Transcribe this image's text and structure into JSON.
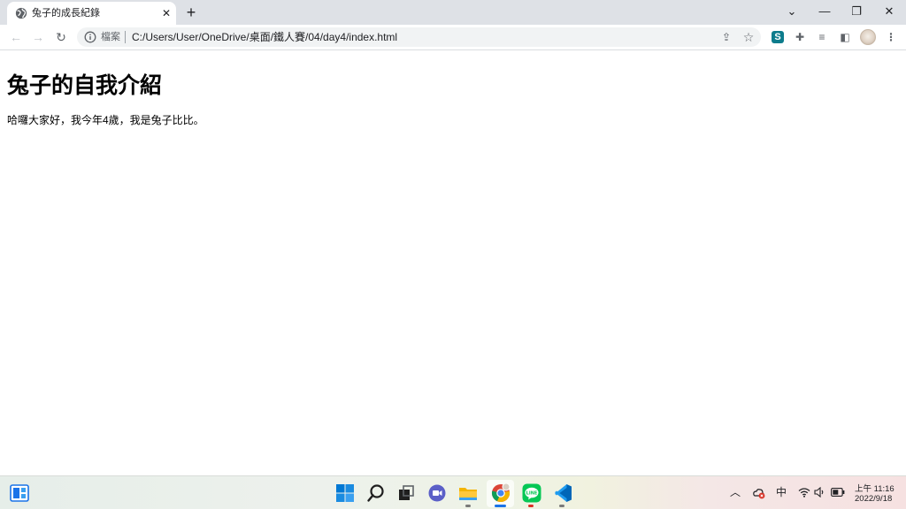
{
  "browser": {
    "tab": {
      "title": "兔子的成長紀錄",
      "favicon": "globe-icon",
      "close_glyph": "✕"
    },
    "new_tab_glyph": "+",
    "window_controls": {
      "tab_search_glyph": "⌄",
      "minimize_glyph": "—",
      "restore_glyph": "❐",
      "close_glyph": "✕"
    },
    "toolbar": {
      "back_glyph": "←",
      "forward_glyph": "→",
      "reload_glyph": "↻",
      "omnibox": {
        "security_label": "檔案",
        "url": "C:/Users/User/OneDrive/桌面/鐵人賽/04/day4/index.html"
      },
      "share_glyph": "⇪",
      "bookmark_glyph": "☆",
      "extension_s_label": "S",
      "extensions_glyph": "✚",
      "reading_list_glyph": "≡",
      "side_panel_glyph": "◧",
      "menu_glyph": "⋮"
    }
  },
  "page": {
    "heading": "兔子的自我介紹",
    "paragraph": "哈囉大家好，我今年4歲，我是兔子比比。"
  },
  "taskbar": {
    "tray": {
      "chevron_glyph": "︿",
      "ime_label": "中",
      "clock_time": "上午 11:16",
      "clock_date": "2022/9/18"
    }
  },
  "colors": {
    "accent": "#1a73e8",
    "tab_strip": "#dee1e6",
    "omnibox": "#f1f3f4",
    "windows_blue": "#0078d4",
    "line_green": "#06c755",
    "vscode_blue": "#0066b8"
  }
}
